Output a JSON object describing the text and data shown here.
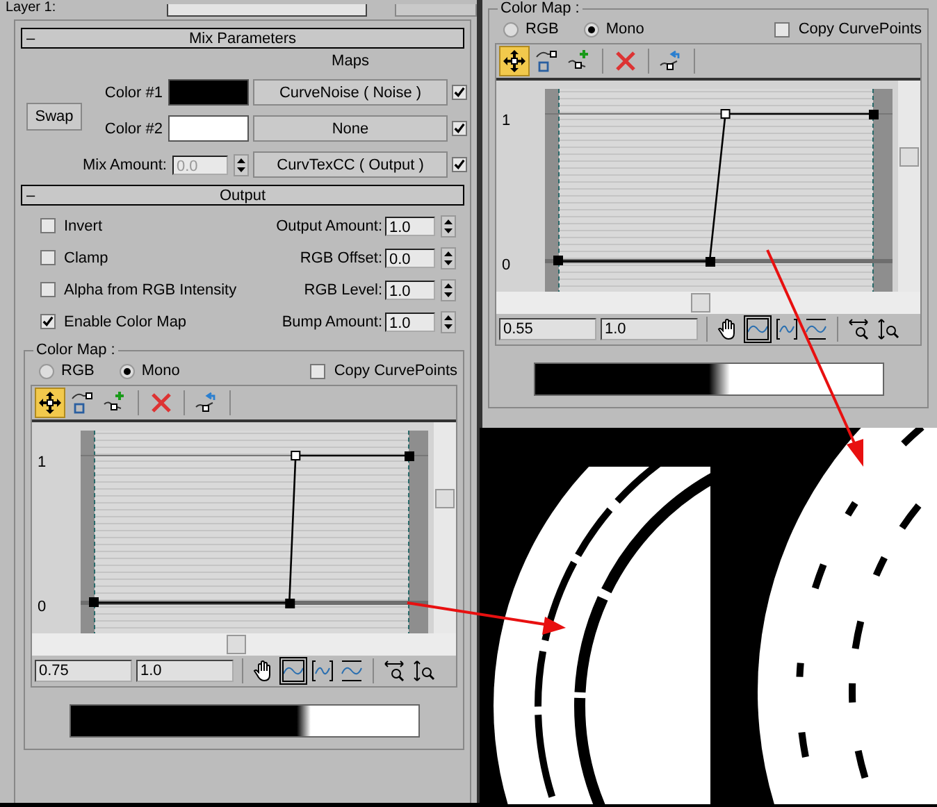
{
  "header": {
    "label": "Layer 1:"
  },
  "mix_parameters": {
    "toggle": "–",
    "title": "Mix Parameters",
    "swap_button": "Swap",
    "maps_heading": "Maps",
    "rows": [
      {
        "kind": "color",
        "label": "Color #1",
        "color": "#000000",
        "map": "CurveNoise ( Noise )",
        "checked": true
      },
      {
        "kind": "color",
        "label": "Color #2",
        "color": "#ffffff",
        "map": "None",
        "checked": true
      },
      {
        "kind": "spinner",
        "label": "Mix Amount:",
        "value": "0.0",
        "disabled": true,
        "map": "CurvTexCC ( Output )",
        "checked": true
      }
    ]
  },
  "output": {
    "toggle": "–",
    "title": "Output",
    "options": [
      {
        "label": "Invert",
        "checked": false
      },
      {
        "label": "Clamp",
        "checked": false
      },
      {
        "label": "Alpha from RGB Intensity",
        "checked": false
      },
      {
        "label": "Enable Color Map",
        "checked": true
      }
    ],
    "spinners": [
      {
        "label": "Output Amount:",
        "value": "1.0"
      },
      {
        "label": "RGB Offset:",
        "value": "0.0"
      },
      {
        "label": "RGB Level:",
        "value": "1.0"
      },
      {
        "label": "Bump Amount:",
        "value": "1.0"
      }
    ]
  },
  "color_maps": [
    {
      "title": "Color Map :",
      "modes": [
        {
          "label": "RGB",
          "selected": false
        },
        {
          "label": "Mono",
          "selected": true
        }
      ],
      "copy_curve_points": {
        "label": "Copy CurvePoints",
        "checked": false
      },
      "y_labels": [
        "1",
        "0"
      ],
      "fields": [
        "0.75",
        "1.0"
      ]
    },
    {
      "title": "Color Map :",
      "modes": [
        {
          "label": "RGB",
          "selected": false
        },
        {
          "label": "Mono",
          "selected": true
        }
      ],
      "copy_curve_points": {
        "label": "Copy CurvePoints",
        "checked": false
      },
      "y_labels": [
        "1",
        "0"
      ],
      "fields": [
        "0.55",
        "1.0"
      ]
    }
  ]
}
